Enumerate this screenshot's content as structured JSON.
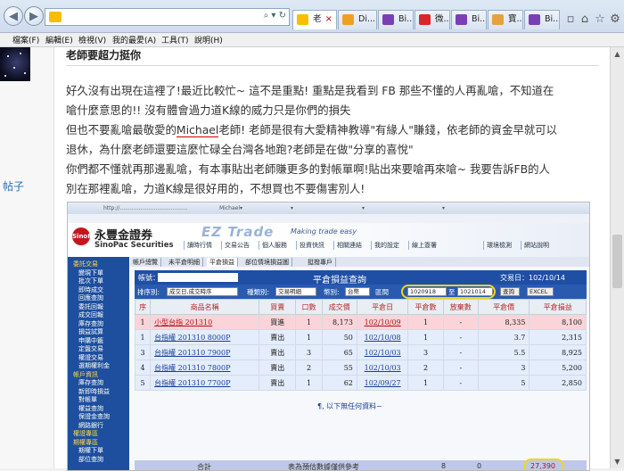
{
  "browser": {
    "tabs": [
      {
        "label": "老"
      },
      {
        "label": "Di..."
      },
      {
        "label": "Bi..."
      },
      {
        "label": "微..."
      },
      {
        "label": "Bi..."
      },
      {
        "label": "寶..."
      },
      {
        "label": "Bi..."
      }
    ],
    "menu": [
      "檔案(F)",
      "編輯(E)",
      "檢視(V)",
      "我的最愛(A)",
      "工具(T)",
      "說明(H)"
    ]
  },
  "sidebar": {
    "link": "帖子"
  },
  "post": {
    "title": "老師要超力挺你",
    "lines": [
      "好久沒有出現在這裡了!最近比較忙~ 這不是重點! 重點是我看到 FB 那些不懂的人再亂嗆，不知道在",
      "嗆什麼意思的!! 沒有體會過力道K線的威力只是你們的損失",
      "但也不要亂嗆最敬愛的",
      "老師! 老師是很有大愛精神教導\"有緣人\"賺錢，依老師的資金早就可以",
      "退休，為什麼老師還要這麼忙碌全台灣各地跑?老師是在做\"分享的喜悅\"",
      "你們都不懂就再那邊亂嗆，有本事貼出老師賺更多的對帳單啊!貼出來要嗆再來嗆~  我要告訴FB的人",
      "別在那裡亂嗆，力道K線是很好用的，不想買也不要傷害別人!"
    ],
    "name": "Michael"
  },
  "screenshot": {
    "brand_name": "永豐金證券",
    "brand_en": "SinoPac Securities",
    "ez": "EZ Trade",
    "ez_tagline": "Making trade easy",
    "topnav": [
      "讀時行情",
      "交易公告",
      "個人服務",
      "投資快訊",
      "相關連結",
      "我的設定",
      "線上簽署",
      "",
      "環境檢測",
      "網站說明"
    ],
    "sidemenu": [
      {
        "label": "委託交易",
        "head": true
      },
      {
        "label": "變現下單"
      },
      {
        "label": "批次下單"
      },
      {
        "label": "即時成交"
      },
      {
        "label": "回應查詢"
      },
      {
        "label": "委託回報"
      },
      {
        "label": "成交回報"
      },
      {
        "label": "庫存查詢"
      },
      {
        "label": "損益試算"
      },
      {
        "label": "申購中籤"
      },
      {
        "label": "定盤交易"
      },
      {
        "label": "權證交易"
      },
      {
        "label": "選期權利金"
      },
      {
        "label": "帳戶資訊",
        "head": true
      },
      {
        "label": "庫存查詢"
      },
      {
        "label": "新即時損益"
      },
      {
        "label": "對帳單"
      },
      {
        "label": "權益查詢"
      },
      {
        "label": "保證金查詢"
      },
      {
        "label": "網路銀行"
      },
      {
        "label": "權證專區",
        "head": true
      },
      {
        "label": "期權專區",
        "head": true
      },
      {
        "label": "期權下單"
      },
      {
        "label": "部位查詢"
      }
    ],
    "subtabs": [
      "帳戶總覽",
      "未平倉明細",
      "平倉損益",
      "部位情境損益圖",
      "挺撥專戶"
    ],
    "header": {
      "account_label": "帳號：",
      "title": "平倉損益查詢",
      "date_label": "交易日：102/10/14"
    },
    "filters": {
      "sort_label": "排序別:",
      "sort_value": "成交日,成交時序",
      "type_label": "種類別:",
      "type_value": "交易明細",
      "currency_label": "幣別:",
      "currency_value": "台幣",
      "range_label": "區間",
      "from": "1020918",
      "to_label": "至",
      "to": "1021014",
      "query": "查詢",
      "excel": "EXCEL"
    },
    "table": {
      "headers": [
        "序",
        "商品名稱",
        "買賣",
        "口數",
        "成交價",
        "平倉日",
        "平倉數",
        "放棄數",
        "平倉價",
        "平倉損益"
      ],
      "rows": [
        {
          "no": "1",
          "product": "小型台指 201310",
          "side": "買進",
          "qty": "1",
          "price": "8,173",
          "date": "102/10/09",
          "closed": "1",
          "waived": "-",
          "close_price": "8,335",
          "pnl": "8,100",
          "style": "pink"
        },
        {
          "no": "1",
          "product": "台指權 201310 8000P",
          "side": "賣出",
          "qty": "1",
          "price": "50",
          "date": "102/10/08",
          "closed": "1",
          "waived": "-",
          "close_price": "3.7",
          "pnl": "2,315",
          "style": "blue"
        },
        {
          "no": "3",
          "product": "台指權 201310 7900P",
          "side": "賣出",
          "qty": "3",
          "price": "65",
          "date": "102/10/03",
          "closed": "3",
          "waived": "-",
          "close_price": "5.5",
          "pnl": "8,925",
          "style": "blue"
        },
        {
          "no": "4",
          "product": "台指權 201310 7800P",
          "side": "賣出",
          "qty": "2",
          "price": "55",
          "date": "102/10/03",
          "closed": "2",
          "waived": "-",
          "close_price": "3",
          "pnl": "5,200",
          "style": "blue"
        },
        {
          "no": "5",
          "product": "台指權 201310 7700P",
          "side": "賣出",
          "qty": "1",
          "price": "62",
          "date": "102/09/27",
          "closed": "1",
          "waived": "-",
          "close_price": "5",
          "pnl": "2,850",
          "style": "blue"
        }
      ],
      "no_more": "¶, 以下無任何資料~"
    },
    "total": {
      "label": "合計",
      "note": "表為預估數據僅供參考",
      "closed": "8",
      "waived": "0",
      "pnl": "27,390"
    }
  }
}
